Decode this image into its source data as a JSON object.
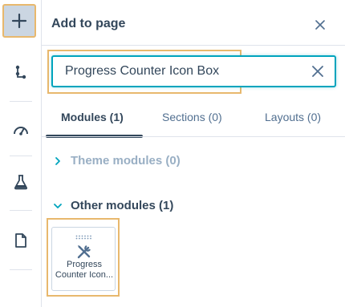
{
  "rail": {
    "items": [
      {
        "name": "add",
        "icon": "plus-icon",
        "active": true
      },
      {
        "name": "tree",
        "icon": "tree-structure-icon",
        "active": false
      },
      {
        "name": "performance",
        "icon": "speedometer-icon",
        "active": false
      },
      {
        "name": "test",
        "icon": "beaker-icon",
        "active": false
      },
      {
        "name": "page",
        "icon": "document-icon",
        "active": false
      }
    ]
  },
  "panel": {
    "title": "Add to page",
    "close_icon": "close-icon"
  },
  "search": {
    "value": "Progress Counter Icon Box",
    "clear_icon": "close-icon"
  },
  "tabs": [
    {
      "label": "Modules (1)",
      "active": true
    },
    {
      "label": "Sections (0)",
      "active": false
    },
    {
      "label": "Layouts (0)",
      "active": false
    }
  ],
  "sections": {
    "theme": {
      "label": "Theme modules (0)",
      "expanded": false
    },
    "other": {
      "label": "Other modules (1)",
      "expanded": true
    }
  },
  "modules": [
    {
      "label": "Progress Counter Icon...",
      "icon": "wrench-screwdriver-icon"
    }
  ],
  "colors": {
    "accent": "#00a4bd",
    "highlight": "#e8b86d",
    "text": "#33475b",
    "muted": "#99afc4"
  }
}
